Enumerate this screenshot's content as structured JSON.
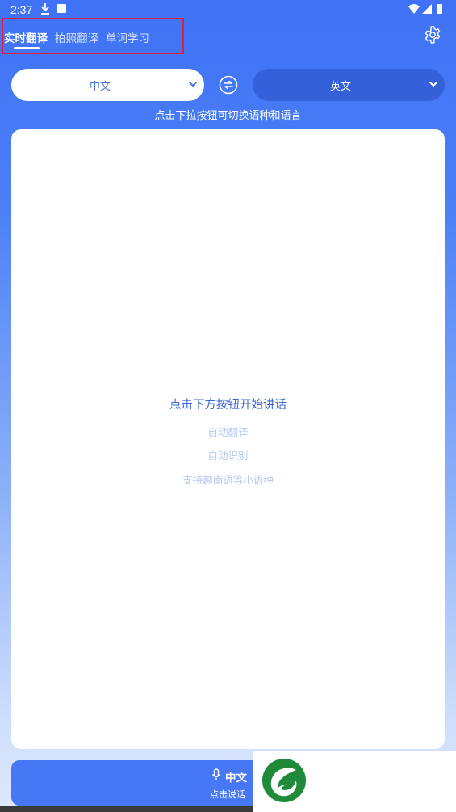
{
  "status_bar": {
    "time": "2:37"
  },
  "tabs": [
    {
      "label": "实时翻译",
      "active": true
    },
    {
      "label": "拍照翻译",
      "active": false
    },
    {
      "label": "单词学习",
      "active": false
    }
  ],
  "language": {
    "source": "中文",
    "target": "英文",
    "hint": "点击下拉按钮可切换语种和语言"
  },
  "card": {
    "title": "点击下方按钮开始讲话",
    "features": [
      "自动翻译",
      "自动识别",
      "支持越南语等小语种"
    ]
  },
  "bottom": {
    "language": "中文",
    "action": "点击说话"
  },
  "colors": {
    "primary": "#3f72f5",
    "target_button": "#3460d9",
    "highlight_border": "#e0203a",
    "logo_green": "#1f8a3a"
  }
}
